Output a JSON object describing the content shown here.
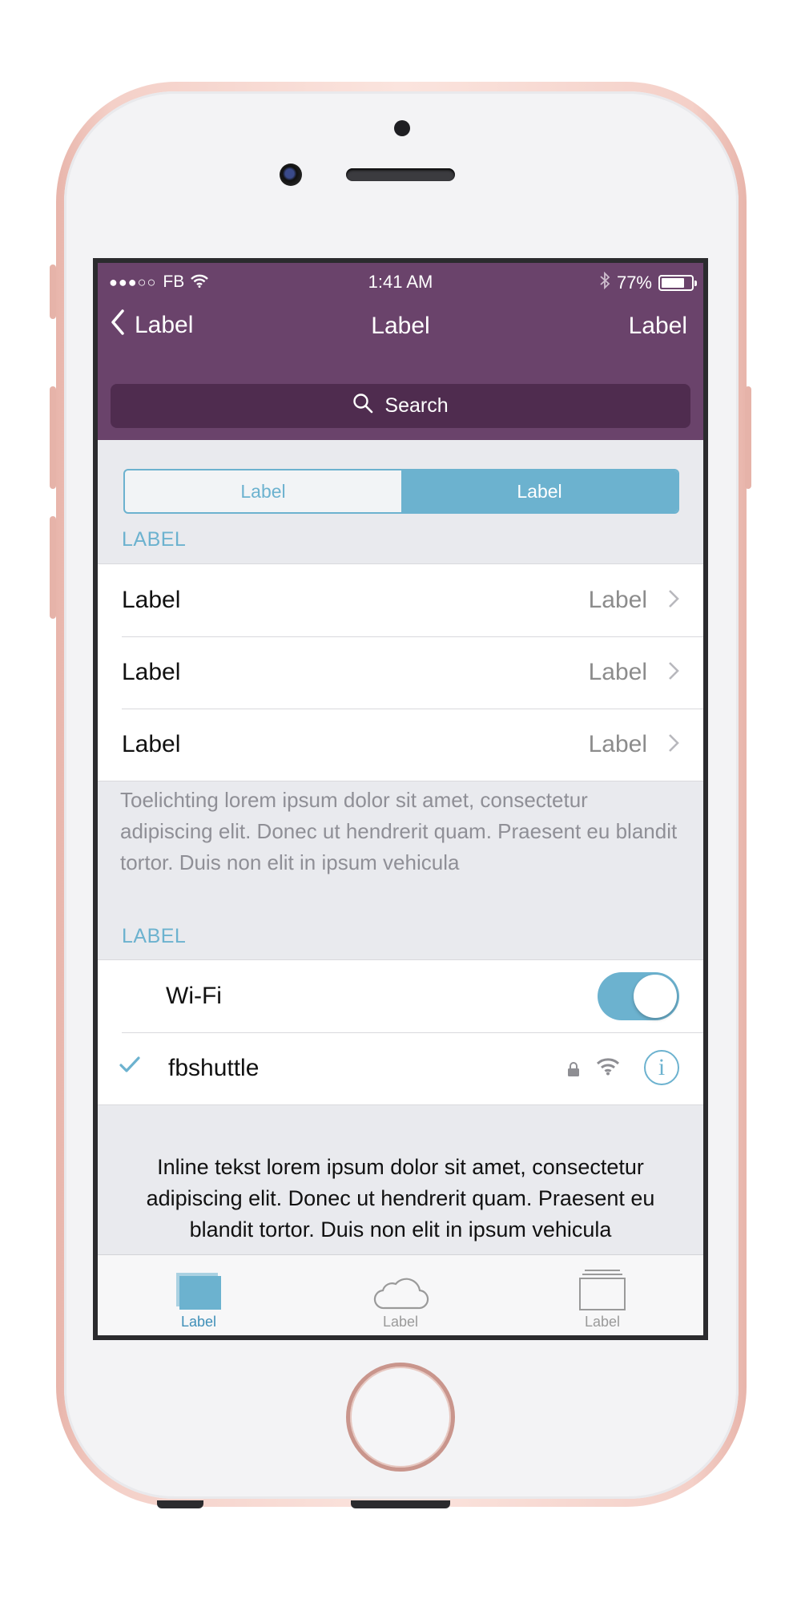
{
  "status_bar": {
    "signal": "●●●○○",
    "carrier": "FB",
    "time": "1:41 AM",
    "battery_percent": "77%",
    "battery_level": 0.77
  },
  "nav": {
    "back_label": "Label",
    "title": "Label",
    "right_label": "Label"
  },
  "search": {
    "placeholder": "Search"
  },
  "segmented_control": {
    "segments": [
      "Label",
      "Label"
    ],
    "selected_index": 1
  },
  "section1": {
    "header": "LABEL",
    "rows": [
      {
        "title": "Label",
        "value": "Label"
      },
      {
        "title": "Label",
        "value": "Label"
      },
      {
        "title": "Label",
        "value": "Label"
      }
    ],
    "footer": "Toelichting lorem ipsum dolor sit amet, consectetur adipiscing elit. Donec ut hendrerit quam. Praesent eu blandit tortor. Duis non elit in ipsum vehicula"
  },
  "section2": {
    "header": "LABEL",
    "wifi_label": "Wi-Fi",
    "wifi_on": true,
    "network_name": "fbshuttle",
    "info_glyph": "i",
    "inline_text": "Inline tekst lorem ipsum dolor sit amet, consectetur adipiscing elit. Donec ut hendrerit quam. Praesent eu blandit tortor. Duis non elit in ipsum vehicula"
  },
  "tab_bar": {
    "tabs": [
      {
        "label": "Label",
        "icon": "stacked-windows-icon"
      },
      {
        "label": "Label",
        "icon": "cloud-icon"
      },
      {
        "label": "Label",
        "icon": "folder-stack-icon"
      }
    ],
    "selected_index": 0
  },
  "colors": {
    "nav_bar": "#6a436b",
    "search_field": "#4f2c4f",
    "accent": "#6cb2cf",
    "background": "#e9eaee"
  }
}
